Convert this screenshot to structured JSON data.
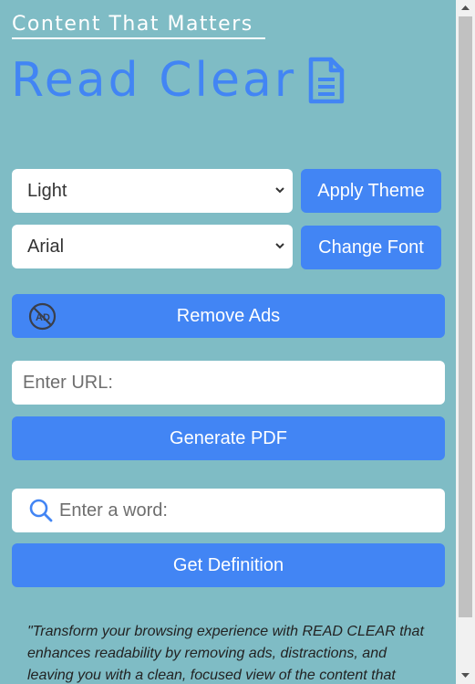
{
  "header": {
    "tagline": "Content That Matters",
    "title": "Read Clear",
    "title_icon": "document-icon"
  },
  "theme": {
    "selected": "Light",
    "button": "Apply Theme"
  },
  "font": {
    "selected": "Arial",
    "button": "Change Font"
  },
  "ads": {
    "button": "Remove Ads",
    "icon": "no-ads-icon"
  },
  "pdf": {
    "placeholder": "Enter URL:",
    "button": "Generate PDF"
  },
  "dictionary": {
    "placeholder": "Enter a word:",
    "icon": "search-icon",
    "button": "Get Definition"
  },
  "description": "\"Transform your browsing experience with READ CLEAR that enhances readability by removing ads, distractions, and leaving you with a clean, focused view of the content that",
  "colors": {
    "background": "#7fbcc5",
    "accent": "#4285f4",
    "text_on_accent": "#ffffff"
  }
}
